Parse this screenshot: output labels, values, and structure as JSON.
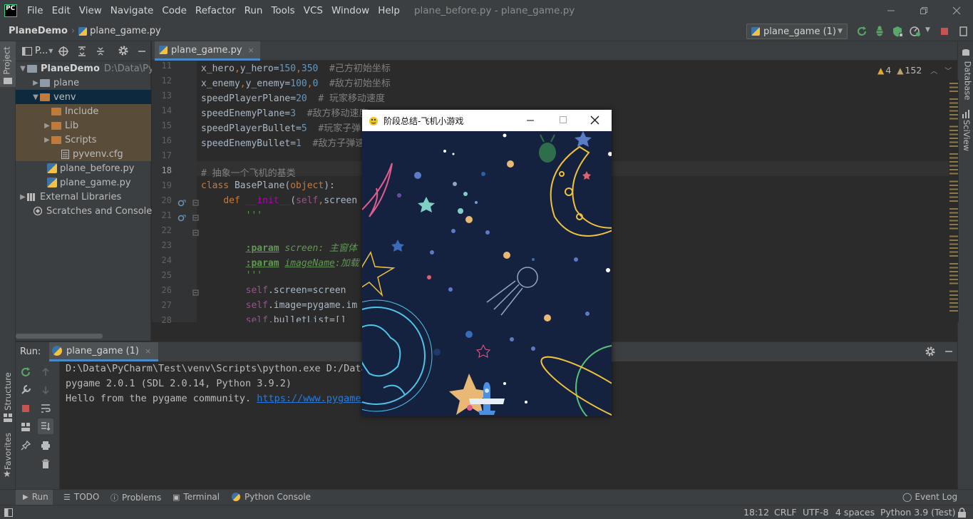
{
  "app": {
    "logo": "PC",
    "window_title": "plane_before.py - plane_game.py"
  },
  "menu": [
    "File",
    "Edit",
    "View",
    "Navigate",
    "Code",
    "Refactor",
    "Run",
    "Tools",
    "VCS",
    "Window",
    "Help"
  ],
  "breadcrumb": {
    "project": "PlaneDemo",
    "file": "plane_game.py"
  },
  "toolbar": {
    "run_config": "plane_game (1)"
  },
  "project_panel": {
    "header": "P...",
    "tree": [
      {
        "label": "PlaneDemo",
        "path": "D:\\Data\\PyCh"
      },
      {
        "label": "plane"
      },
      {
        "label": "venv"
      },
      {
        "label": "Include"
      },
      {
        "label": "Lib"
      },
      {
        "label": "Scripts"
      },
      {
        "label": "pyvenv.cfg"
      },
      {
        "label": "plane_before.py"
      },
      {
        "label": "plane_game.py"
      },
      {
        "label": "External Libraries"
      },
      {
        "label": "Scratches and Consoles"
      }
    ]
  },
  "editor": {
    "tab": "plane_game.py",
    "warnings": "4",
    "weak_warnings": "152",
    "line_numbers": [
      "11",
      "12",
      "13",
      "14",
      "15",
      "16",
      "17",
      "18",
      "19",
      "20",
      "21",
      "22",
      "23",
      "24",
      "25",
      "26",
      "27",
      "28"
    ]
  },
  "side_labels": {
    "project": "Project",
    "structure": "Structure",
    "favorites": "Favorites",
    "database": "Database",
    "sciview": "SciView"
  },
  "run_panel": {
    "title": "Run:",
    "tab": "plane_game (1)",
    "output": [
      "D:\\Data\\PyCharm\\Test\\venv\\Scripts\\python.exe D:/Data",
      "pygame 2.0.1 (SDL 2.0.14, Python 3.9.2)",
      "Hello from the pygame community. "
    ],
    "link": "https://www.pygame."
  },
  "bottom_tabs": [
    "Run",
    "TODO",
    "Problems",
    "Terminal",
    "Python Console"
  ],
  "event_log": "Event Log",
  "status": {
    "position": "18:12",
    "line_sep": "CRLF",
    "encoding": "UTF-8",
    "indent": "4 spaces",
    "interpreter": "Python 3.9 (Test)"
  },
  "game_window": {
    "title": "阶段总结-飞机小游戏"
  }
}
